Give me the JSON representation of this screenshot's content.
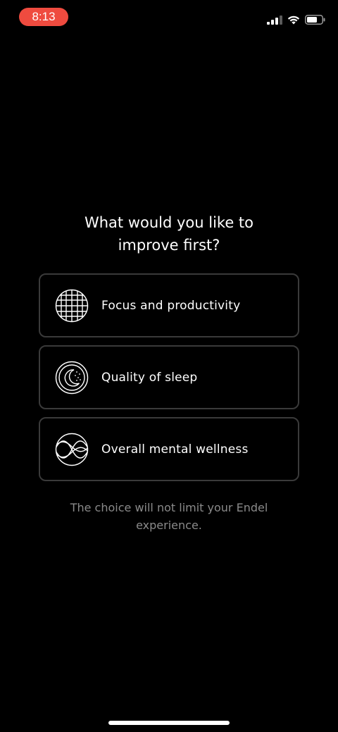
{
  "status_bar": {
    "time": "8:13",
    "time_pill_color": "#ef4b3f",
    "icons": [
      "cellular-signal-icon",
      "wifi-icon",
      "battery-icon"
    ]
  },
  "question": {
    "line1": "What would you like to",
    "line2": "improve first?"
  },
  "options": [
    {
      "label": "Focus and productivity",
      "icon": "grid-sphere-icon"
    },
    {
      "label": "Quality of sleep",
      "icon": "moon-stars-icon"
    },
    {
      "label": "Overall mental wellness",
      "icon": "waves-circle-icon"
    }
  ],
  "footnote": {
    "line1": "The choice will not limit your Endel",
    "line2": "experience."
  },
  "colors": {
    "background": "#000000",
    "text": "#ffffff",
    "muted_text": "#8a8a8a",
    "card_border": "#3a3a3a"
  }
}
